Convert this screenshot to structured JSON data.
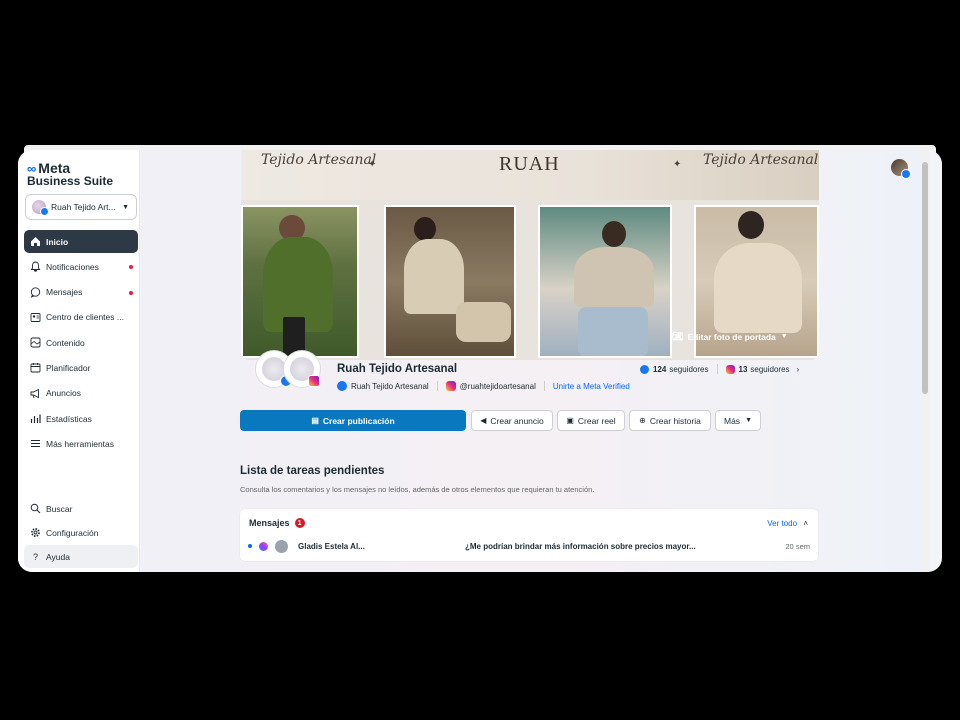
{
  "app": {
    "brand_line1": "Meta",
    "brand_line2": "Business Suite"
  },
  "account": {
    "name": "Ruah Tejido Art..."
  },
  "sidebar": {
    "items": [
      {
        "label": "Inicio",
        "icon": "home-icon",
        "active": true
      },
      {
        "label": "Notificaciones",
        "icon": "bell-icon",
        "badge": true
      },
      {
        "label": "Mensajes",
        "icon": "message-icon",
        "badge": true
      },
      {
        "label": "Centro de clientes ...",
        "icon": "contacts-icon"
      },
      {
        "label": "Contenido",
        "icon": "content-icon"
      },
      {
        "label": "Planificador",
        "icon": "calendar-icon"
      },
      {
        "label": "Anuncios",
        "icon": "megaphone-icon"
      },
      {
        "label": "Estadísticas",
        "icon": "chart-icon"
      },
      {
        "label": "Más herramientas",
        "icon": "menu-icon"
      }
    ],
    "bottom": [
      {
        "label": "Buscar",
        "icon": "search-icon"
      },
      {
        "label": "Configuración",
        "icon": "gear-icon"
      },
      {
        "label": "Ayuda",
        "icon": "help-icon"
      }
    ]
  },
  "cover": {
    "left_script": "Tejido Artesanal",
    "center_logo": "RUAH",
    "right_script": "Tejido Artesanal",
    "edit_label": "Editar foto de portada"
  },
  "page": {
    "name": "Ruah Tejido Artesanal",
    "facebook_handle": "Ruah Tejido Artesanal",
    "instagram_handle": "@ruahtejidoartesanal",
    "verified_link": "Unirte a Meta Verified",
    "fb_followers": "124",
    "ig_followers": "13",
    "followers_label": "seguidores"
  },
  "actions": {
    "create_post": "Crear publicación",
    "create_ad": "Crear anuncio",
    "create_reel": "Crear reel",
    "create_story": "Crear historia",
    "more": "Más"
  },
  "tasks": {
    "title": "Lista de tareas pendientes",
    "description": "Consulta los comentarios y los mensajes no leídos, además de otros elementos que requieran tu atención.",
    "card_title": "Mensajes",
    "count": "1",
    "see_all": "Ver todo",
    "message": {
      "sender": "Gladis Estela Al...",
      "text": "¿Me podrían brindar más información sobre precios mayor...",
      "time": "20 sem"
    }
  },
  "colors": {
    "primary": "#0a78be",
    "active_nav": "#2d3a45",
    "link": "#0866ff",
    "badge": "#d11a2a"
  }
}
